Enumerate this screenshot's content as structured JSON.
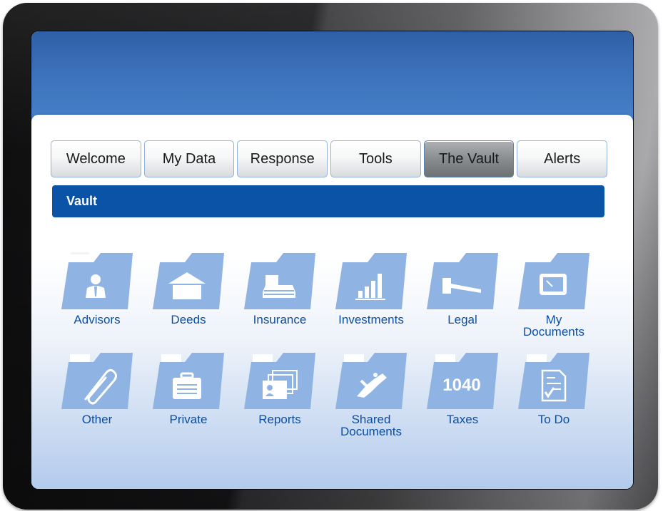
{
  "tabs": [
    {
      "label": "Welcome",
      "active": false
    },
    {
      "label": "My Data",
      "active": false
    },
    {
      "label": "Response",
      "active": false
    },
    {
      "label": "Tools",
      "active": false
    },
    {
      "label": "The Vault",
      "active": true
    },
    {
      "label": "Alerts",
      "active": false
    }
  ],
  "section": {
    "title": "Vault"
  },
  "folders": [
    {
      "label": "Advisors",
      "icon": "person-tie-icon"
    },
    {
      "label": "Deeds",
      "icon": "house-icon"
    },
    {
      "label": "Insurance",
      "icon": "car-icon"
    },
    {
      "label": "Investments",
      "icon": "bar-chart-icon"
    },
    {
      "label": "Legal",
      "icon": "gavel-icon"
    },
    {
      "label": "My Documents",
      "icon": "monitor-icon"
    },
    {
      "label": "Other",
      "icon": "paperclip-icon"
    },
    {
      "label": "Private",
      "icon": "briefcase-icon"
    },
    {
      "label": "Reports",
      "icon": "id-cards-icon"
    },
    {
      "label": "Shared Documents",
      "icon": "handshake-icon"
    },
    {
      "label": "Taxes",
      "icon": "1040-form-icon",
      "glyph": "1040"
    },
    {
      "label": "To Do",
      "icon": "checklist-icon"
    }
  ],
  "colors": {
    "folder": "#8fb3e3",
    "folder_tab": "#ffffff",
    "label": "#0b4ea3",
    "section_bar": "#0a53a6",
    "screen_top": "#3c72bb"
  }
}
